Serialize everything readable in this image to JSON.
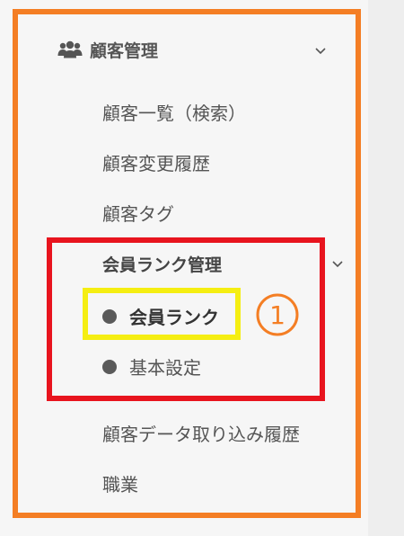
{
  "sidebar": {
    "section_title": "顧客管理",
    "items": [
      {
        "label": "顧客一覧（検索）"
      },
      {
        "label": "顧客変更履歴"
      },
      {
        "label": "顧客タグ"
      }
    ],
    "member_rank": {
      "title": "会員ランク管理",
      "subitems": [
        {
          "label": "会員ランク",
          "active": true
        },
        {
          "label": "基本設定",
          "active": false
        }
      ]
    },
    "items_after": [
      {
        "label": "顧客データ取り込み履歴"
      },
      {
        "label": "職業"
      }
    ]
  },
  "annotations": {
    "step_marker": "1",
    "colors": {
      "outer_frame": "#f47e24",
      "group_box": "#e8141e",
      "highlight_box": "#f5ee12",
      "step_marker": "#f47e24"
    }
  },
  "icons": {
    "section": "users-icon",
    "expand": "chevron-down-icon",
    "bullet": "bullet-dot-icon"
  }
}
